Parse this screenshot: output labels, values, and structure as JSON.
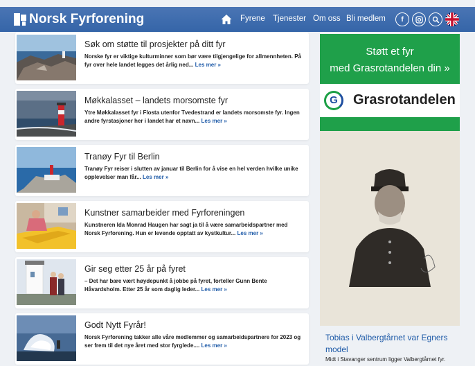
{
  "header": {
    "brand": "Norsk Fyrforening",
    "nav": [
      {
        "label": "Fyrene"
      },
      {
        "label": "Tjenester"
      },
      {
        "label": "Om oss"
      },
      {
        "label": "Bli medlem"
      }
    ],
    "social": [
      "facebook-icon",
      "instagram-icon",
      "search-icon",
      "uk-flag-icon"
    ],
    "color": "#3d6cae"
  },
  "articles": [
    {
      "title": "Søk om støtte til prosjekter på ditt fyr",
      "text": "Norske fyr er viktige kulturminner som bør være tilgjengelige for allmennheten. På fyr over hele landet legges det årlig ned...",
      "more": "Les mer »"
    },
    {
      "title": "Møkkalasset – landets morsomste fyr",
      "text": "Ytre Møkkalasset fyr i Flosta utenfor Tvedestrand er landets morsomste fyr. Ingen andre fyrstasjoner her i landet har et navn...",
      "more": "Les mer »"
    },
    {
      "title": "Tranøy Fyr til Berlin",
      "text": "Tranøy Fyr reiser i slutten av januar til Berlin for å vise en hel verden hvilke unike opplevelser man får...",
      "more": "Les mer »"
    },
    {
      "title": "Kunstner samarbeider med Fyrforeningen",
      "text": "Kunstneren Ida Monrad Haugen har sagt ja til å være samarbeidspartner med Norsk Fyrforening. Hun er levende opptatt av kystkultur...",
      "more": "Les mer »"
    },
    {
      "title": "Gir seg etter 25 år på fyret",
      "text": "– Det har bare vært høydepunkt å jobbe på fyret, forteller Gunn Bente Håvardsholm. Etter 25 år som daglig leder...",
      "more": "Les mer »"
    },
    {
      "title": "Godt Nytt Fyrår!",
      "text": "Norsk Fyrforening takker alle våre medlemmer og samarbeidspartnere for 2023 og ser frem til det nye året med stor fyrglede....",
      "more": "Les mer »"
    }
  ],
  "sidebar": {
    "promo_line1": "Støtt et fyr",
    "promo_line2": "med Grasrotandelen din »",
    "grasrot_letter": "G",
    "grasrot_name": "Grasrotandelen",
    "feature_title": "Tobias i Valbergtårnet var Egners model",
    "feature_text": "Midt i Stavanger sentrum ligger Valbergtårnet fyr.",
    "green": "#1fa04a"
  }
}
